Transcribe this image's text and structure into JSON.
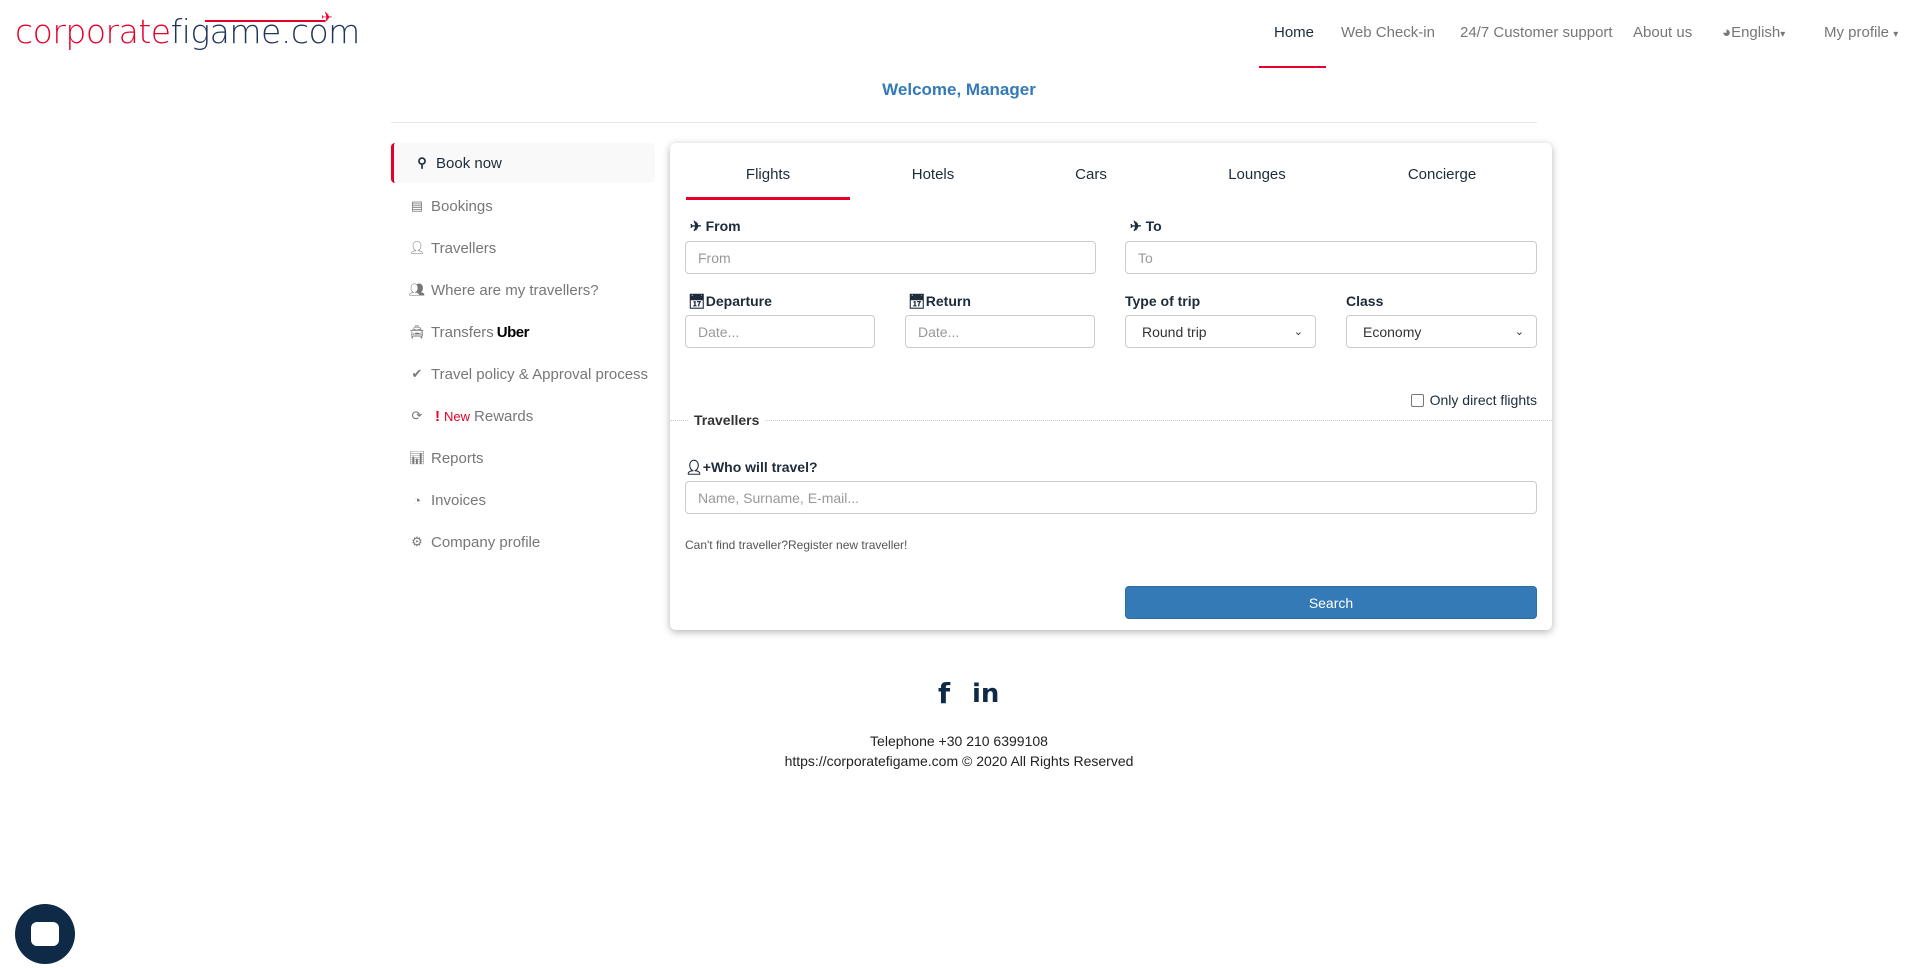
{
  "brand": {
    "logo_text_red": "corporate",
    "logo_text_blue": "figame.com",
    "accent": "#e4002b",
    "primary": "#337ab7"
  },
  "nav": {
    "items": [
      "Home",
      "Web Check-in",
      "24/7 Customer support",
      "About us",
      "English",
      "My profile"
    ]
  },
  "welcome": "Welcome, Manager",
  "sidebar": {
    "items": [
      {
        "icon": "search-icon",
        "label": "Book now"
      },
      {
        "icon": "list-icon",
        "label": "Bookings"
      },
      {
        "icon": "user-icon",
        "label": "Travellers"
      },
      {
        "icon": "users-icon",
        "label": "Where are my travellers?"
      },
      {
        "icon": "taxi-icon",
        "label": "Transfers",
        "badge": "Uber"
      },
      {
        "icon": "check-icon",
        "label": "Travel policy & Approval process"
      },
      {
        "icon": "refresh-icon",
        "label": "Rewards",
        "badge": "New"
      },
      {
        "icon": "bar-chart-icon",
        "label": "Reports"
      },
      {
        "icon": "pie-chart-icon",
        "label": "Invoices"
      },
      {
        "icon": "gear-icon",
        "label": "Company profile"
      }
    ]
  },
  "tabs": [
    "Flights",
    "Hotels",
    "Cars",
    "Lounges",
    "Concierge"
  ],
  "form": {
    "from_label": "From",
    "from_placeholder": "From",
    "to_label": "To",
    "to_placeholder": "To",
    "departure_label": "Departure",
    "departure_placeholder": "Date...",
    "return_label": "Return",
    "return_placeholder": "Date...",
    "trip_label": "Type of trip",
    "trip_value": "Round trip",
    "class_label": "Class",
    "class_value": "Economy",
    "direct_label": "Only direct flights",
    "travellers_legend": "Travellers",
    "who_label": "Who will travel?",
    "who_placeholder": "Name, Surname, E-mail...",
    "cant_find": "Can't find traveller?Register new traveller!",
    "search": "Search"
  },
  "footer": {
    "telephone": "Telephone +30 210 6399108",
    "copyright": "https://corporatefigame.com © 2020 All Rights Reserved"
  }
}
